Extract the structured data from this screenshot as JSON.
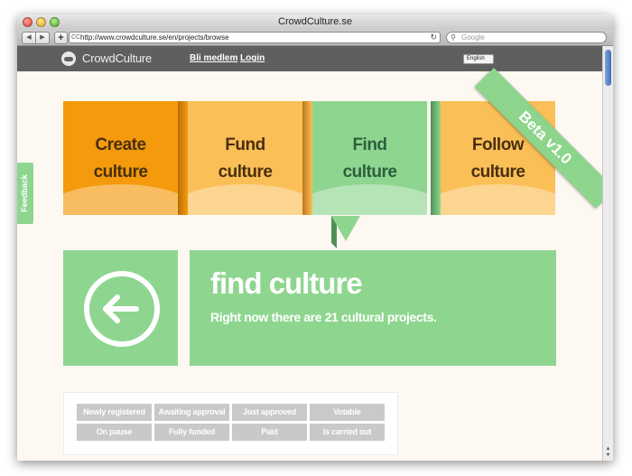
{
  "window": {
    "title": "CrowdCulture.se"
  },
  "toolbar": {
    "url": "http://www.crowdculture.se/en/projects/browse",
    "favicon_text": "CC",
    "search_placeholder": "Google",
    "back_glyph": "◀",
    "forward_glyph": "▶",
    "add_glyph": "+",
    "reload_glyph": "↻"
  },
  "site": {
    "logo_text": "CrowdCulture",
    "links": {
      "member": "Bli medlem",
      "login": "Login"
    },
    "language": "English",
    "beta": "Beta v1.0",
    "feedback": "Feedback"
  },
  "tiles": [
    {
      "line1": "Create",
      "line2": "culture",
      "color": "#f49a0c",
      "side_color": "#b86d05",
      "text_color": "#4a2f10"
    },
    {
      "line1": "Fund",
      "line2": "culture",
      "color": "#fbbf57",
      "side_color": "#c1761a",
      "text_color": "#4a2f10"
    },
    {
      "line1": "Find",
      "line2": "culture",
      "color": "#8ed68f",
      "side_color": "#4f8f57",
      "text_color": "#2c5f3d"
    },
    {
      "line1": "Follow",
      "line2": "culture",
      "color": "#fbbf57",
      "side_color": "#c1761a",
      "text_color": "#4a2f10"
    }
  ],
  "main": {
    "heading": "find culture",
    "subheading": "Right now there are 21 cultural projects."
  },
  "filters": [
    "Newly registered",
    "Awaiting approval",
    "Just approved",
    "Votable",
    "On pause",
    "Fully funded",
    "Paid",
    "Is carried out"
  ]
}
